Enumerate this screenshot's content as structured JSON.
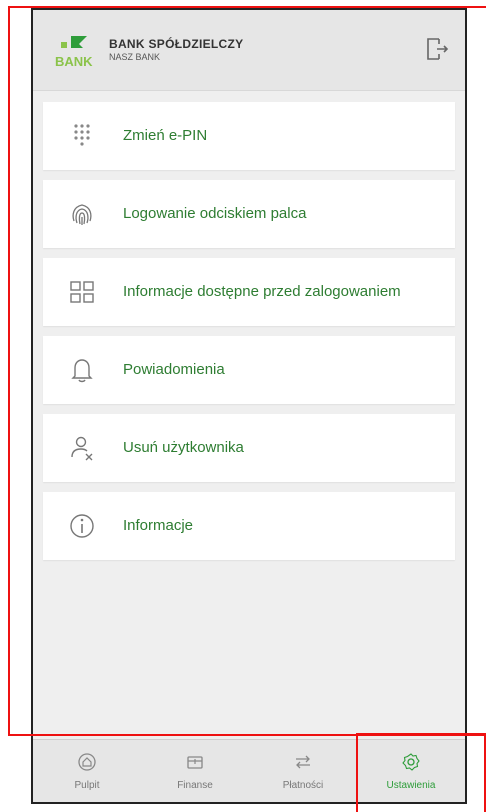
{
  "header": {
    "logo_text": "BANK",
    "bank_name": "BANK SPÓŁDZIELCZY",
    "bank_sub": "NASZ BANK"
  },
  "menu": [
    {
      "label": "Zmień e-PIN",
      "icon": "keypad-icon"
    },
    {
      "label": "Logowanie odciskiem palca",
      "icon": "fingerprint-icon"
    },
    {
      "label": "Informacje dostępne przed zalogowaniem",
      "icon": "grid-icon"
    },
    {
      "label": "Powiadomienia",
      "icon": "bell-icon"
    },
    {
      "label": "Usuń użytkownika",
      "icon": "remove-user-icon"
    },
    {
      "label": "Informacje",
      "icon": "info-icon"
    }
  ],
  "nav": [
    {
      "label": "Pulpit",
      "icon": "home-icon"
    },
    {
      "label": "Finanse",
      "icon": "wallet-icon"
    },
    {
      "label": "Płatności",
      "icon": "transfer-icon"
    },
    {
      "label": "Ustawienia",
      "icon": "settings-icon",
      "active": true
    }
  ],
  "colors": {
    "accent": "#2e7d32",
    "active_nav": "#2e9d3a",
    "highlight": "#e11111"
  }
}
